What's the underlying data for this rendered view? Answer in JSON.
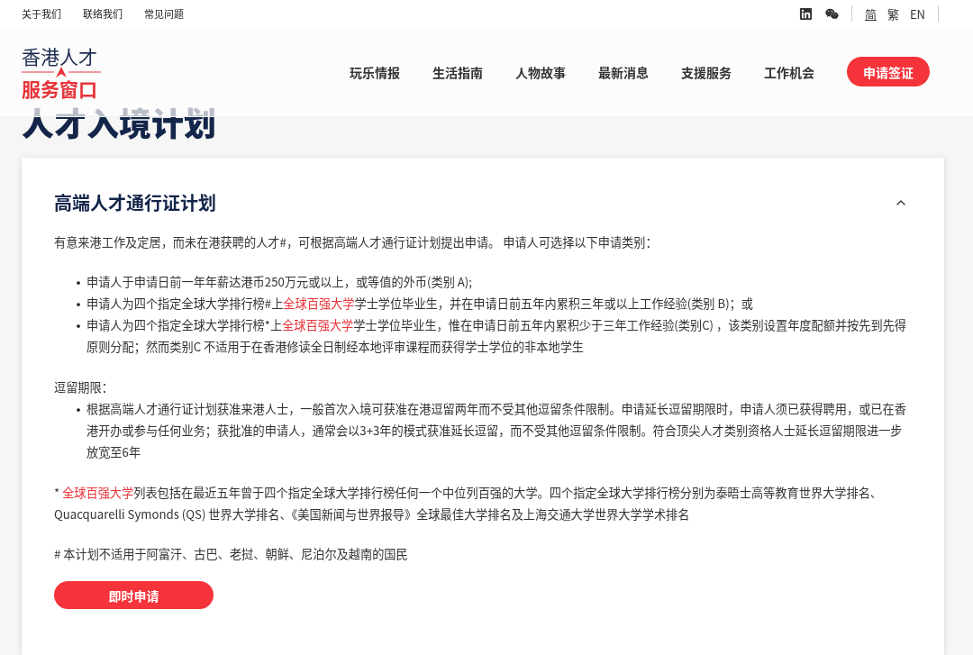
{
  "top_links": [
    "关于我们",
    "联络我们",
    "常见问题"
  ],
  "languages": [
    {
      "label": "简",
      "selected": true
    },
    {
      "label": "繁",
      "selected": false
    },
    {
      "label": "EN",
      "selected": false
    }
  ],
  "logo": {
    "top": "香港人才",
    "bottom": "服务窗口"
  },
  "nav": [
    "玩乐情报",
    "生活指南",
    "人物故事",
    "最新消息",
    "支援服务",
    "工作机会"
  ],
  "nav_button": "申请签证",
  "page_title": "人才入境计划",
  "section": {
    "title": "高端人才通行证计划",
    "expanded": true,
    "intro": "有意来港工作及定居，而未在港获聘的人才#，可根据高端人才通行证计划提出申请。 申请人可选择以下申请类别：",
    "categories": [
      {
        "bullet": "•",
        "parts": [
          {
            "text": "申请人于申请日前一年年薪达港币250万元或以上，或等值的外币(类别 A);",
            "highlight": false
          }
        ]
      },
      {
        "bullet": "•",
        "parts": [
          {
            "text": "申请人为四个指定全球大学排行榜#上",
            "highlight": false
          },
          {
            "text": "全球百强大学",
            "highlight": true
          },
          {
            "text": "学士学位毕业生，并在申请日前五年内累积三年或以上工作经验(类别 B)；或",
            "highlight": false
          }
        ]
      },
      {
        "bullet": "•",
        "parts": [
          {
            "text": "申请人为四个指定全球大学排行榜*上",
            "highlight": false
          },
          {
            "text": "全球百强大学",
            "highlight": true
          },
          {
            "text": "学士学位毕业生，惟在申请日前五年内累积少于三年工作经验(类别C) ，该类别设置年度配额并按先到先得原则分配；然而类别C 不适用于在香港修读全日制经本地评审课程而获得学士学位的非本地学生",
            "highlight": false
          }
        ]
      }
    ],
    "stay_label": "逗留期限：",
    "stay_items": [
      {
        "bullet": "•",
        "parts": [
          {
            "text": "根据高端人才通行证计划获准来港人士，一般首次入境可获准在港逗留两年而不受其他逗留条件限制。申请延长逗留期限时，申请人须已获得聘用，或已在香港开办或参与任何业务；获批准的申请人，通常会以3+3年的模式获准延长逗留，而不受其他逗留条件限制。符合顶尖人才类别资格人士延长逗留期限进一步放宽至6年",
            "highlight": false
          }
        ]
      }
    ],
    "footnote": [
      {
        "text": "* ",
        "highlight": false
      },
      {
        "text": "全球百强大学",
        "highlight": true
      },
      {
        "text": "列表包括在最近五年曾于四个指定全球大学排行榜任何一个中位列百强的大学。四个指定全球大学排行榜分别为泰晤士高等教育世界大学排名、Quacquarelli Symonds (QS) 世界大学排名、《美国新闻与世界报导》全球最佳大学排名及上海交通大学世界大学学术排名",
        "highlight": false
      }
    ],
    "note": "# 本计划不适用于阿富汗、古巴、老挝、朝鲜、尼泊尔及越南的国民",
    "apply_button": "即时申请"
  }
}
